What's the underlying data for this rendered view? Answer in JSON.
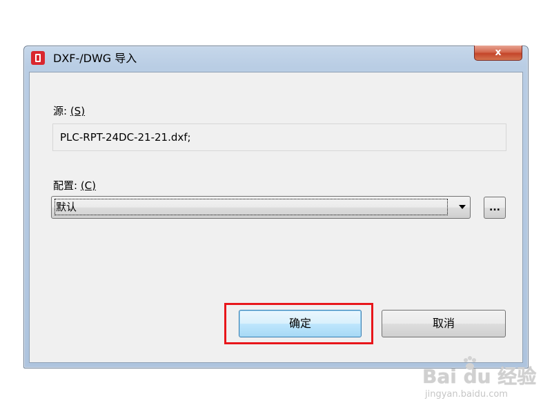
{
  "window": {
    "title": "DXF-/DWG 导入",
    "close_glyph": "x"
  },
  "source": {
    "label": "源: ",
    "mnemonic": "(S)",
    "value": "PLC-RPT-24DC-21-21.dxf;"
  },
  "config": {
    "label": "配置: ",
    "mnemonic": "(C)",
    "selected": "默认",
    "browse_label": "..."
  },
  "buttons": {
    "ok_label": "确定",
    "cancel_label": "取消"
  },
  "annotation": {
    "highlight_color": "#e8161b"
  },
  "watermark": {
    "logo_text": "Bai du 经验",
    "url_text": "jingyan.baidu.com"
  },
  "icons": {
    "app": "app-logo-icon",
    "close": "close-icon",
    "dropdown": "chevron-down-icon"
  }
}
